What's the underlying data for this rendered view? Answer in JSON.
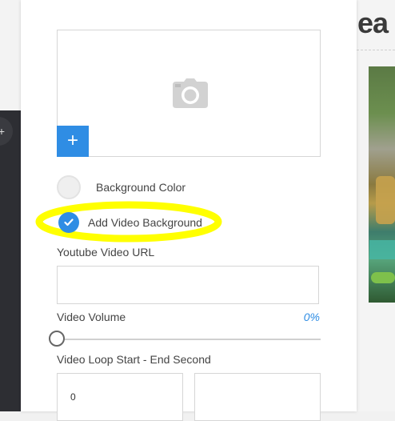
{
  "background": {
    "heading_text": "ea",
    "left_button_glyph": "+"
  },
  "panel": {
    "image_upload": {
      "icon": "camera-icon",
      "add_button_label": "+"
    },
    "options": [
      {
        "label": "Background Color",
        "selected": false
      },
      {
        "label": "Add Video Background",
        "selected": true
      }
    ],
    "youtube_url": {
      "label": "Youtube Video URL",
      "value": ""
    },
    "video_volume": {
      "label": "Video Volume",
      "value_text": "0%",
      "value": 0
    },
    "video_loop": {
      "label": "Video Loop Start - End Second",
      "start_value": "0",
      "end_value": ""
    }
  },
  "colors": {
    "accent": "#2f8de4",
    "highlight": "#ffff00"
  }
}
